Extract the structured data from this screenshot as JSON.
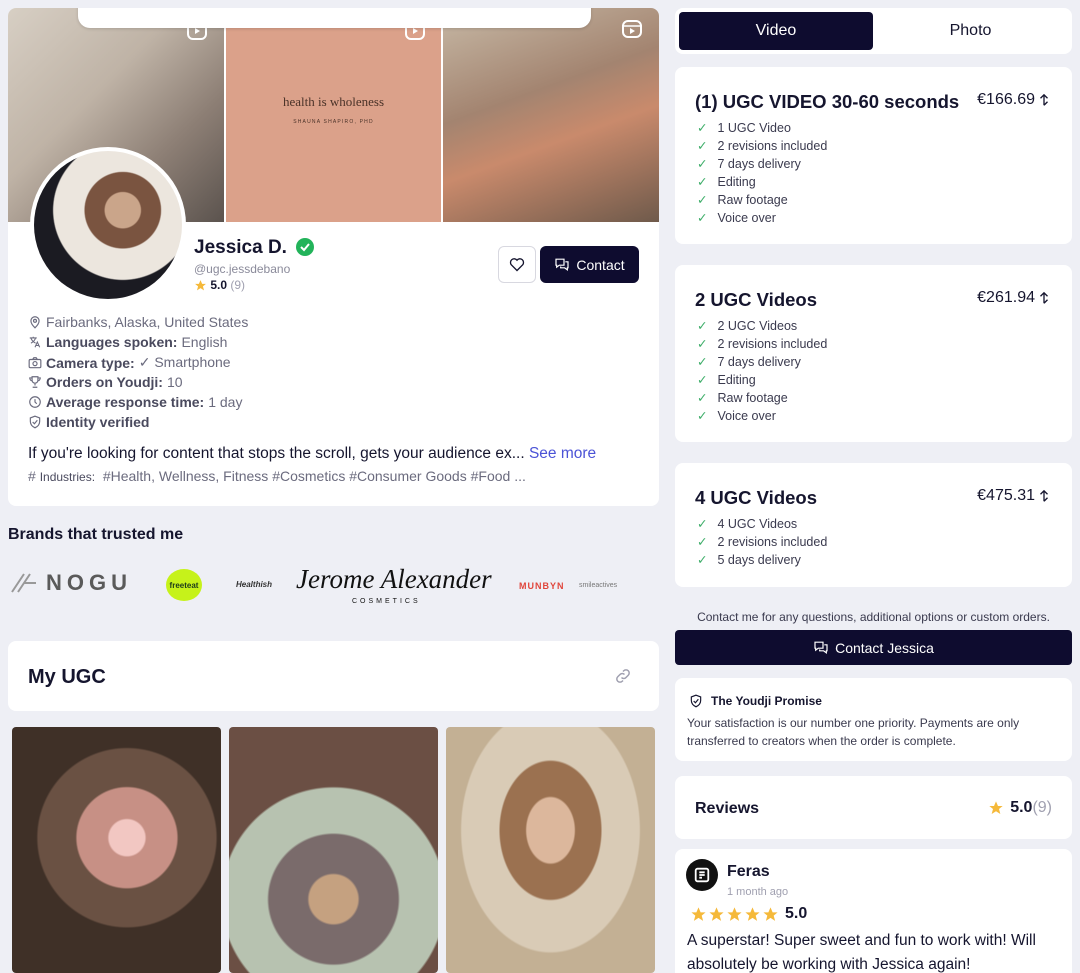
{
  "profile": {
    "banner_quote": "health is wholeness",
    "banner_quote_sub": "SHAUNA SHAPIRO, PHD",
    "name": "Jessica D.",
    "handle": "@ugc.jessdebano",
    "rating": "5.0",
    "rating_count": "(9)",
    "contact_label": "Contact",
    "location": "Fairbanks, Alaska, United States",
    "languages_label": "Languages spoken:",
    "languages_value": "English",
    "camera_label": "Camera type:",
    "camera_value": "✓ Smartphone",
    "orders_label": "Orders on Youdji:",
    "orders_value": "10",
    "response_label": "Average response time:",
    "response_value": "1 day",
    "identity_label": "Identity verified",
    "bio": "If you're looking for content that stops the scroll, gets your audience ex...",
    "see_more": "See more",
    "industries_label": "Industries:",
    "industries_value": "#Health, Wellness, Fitness #Cosmetics #Consumer Goods #Food ..."
  },
  "brands": {
    "title": "Brands that trusted me",
    "logos": [
      "NOGU",
      "freeteat",
      "Healthish",
      "Jerome Alexander",
      "COSMETICS",
      "MUNBYN",
      "smileactives"
    ]
  },
  "my_ugc": {
    "title": "My UGC"
  },
  "tabs": {
    "video": "Video",
    "photo": "Photo"
  },
  "packages": [
    {
      "title": "(1) UGC VIDEO 30-60 seconds",
      "price": "€166.69",
      "features": [
        "1 UGC Video",
        "2 revisions included",
        "7 days delivery",
        "Editing",
        "Raw footage",
        "Voice over"
      ]
    },
    {
      "title": "2 UGC Videos",
      "price": "€261.94",
      "features": [
        "2 UGC Videos",
        "2 revisions included",
        "7 days delivery",
        "Editing",
        "Raw footage",
        "Voice over"
      ]
    },
    {
      "title": "4 UGC Videos",
      "price": "€475.31",
      "features": [
        "4 UGC Videos",
        "2 revisions included",
        "5 days delivery"
      ]
    }
  ],
  "contact_note": "Contact me for any questions, additional options or custom orders.",
  "contact_jessica": "Contact Jessica",
  "promise": {
    "title": "The Youdji Promise",
    "text": "Your satisfaction is our number one priority. Payments are only transferred to creators when the order is complete."
  },
  "reviews": {
    "title": "Reviews",
    "rating": "5.0",
    "count": "(9)"
  },
  "review": {
    "name": "Feras",
    "date": "1 month ago",
    "score": "5.0",
    "text": "A superstar! Super sweet and fun to work with! Will absolutely be working with Jessica again!"
  },
  "colors": {
    "primary": "#0e0c2f",
    "accent_link": "#4b53d6",
    "check": "#3fae6a",
    "star": "#f5b93a",
    "verified": "#22b35a"
  }
}
